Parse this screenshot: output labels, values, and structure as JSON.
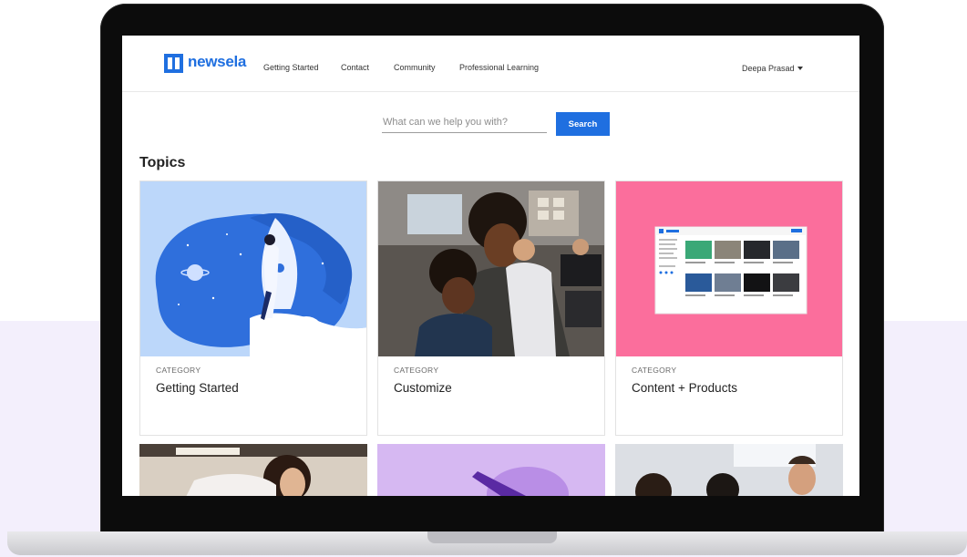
{
  "brand": {
    "name": "newsela",
    "color": "#1f6fe0"
  },
  "nav": {
    "items": [
      {
        "label": "Getting Started"
      },
      {
        "label": "Contact"
      },
      {
        "label": "Community"
      },
      {
        "label": "Professional Learning"
      }
    ],
    "user_name": "Deepa Prasad"
  },
  "search": {
    "placeholder": "What can we help you with?",
    "value": "",
    "button_label": "Search"
  },
  "topics": {
    "heading": "Topics",
    "cards": [
      {
        "category": "CATEGORY",
        "title": "Getting Started",
        "image": "rocket-illustration",
        "bg": "#bcd7fa"
      },
      {
        "category": "CATEGORY",
        "title": "Customize",
        "image": "classroom-photo",
        "bg": "#6b6259"
      },
      {
        "category": "CATEGORY",
        "title": "Content + Products",
        "image": "product-screenshot",
        "bg": "#fb6e9c"
      }
    ]
  },
  "colors": {
    "accent": "#1f6fe0",
    "page_band": "#f3effc",
    "laptop_frame": "#0c0c0c"
  }
}
